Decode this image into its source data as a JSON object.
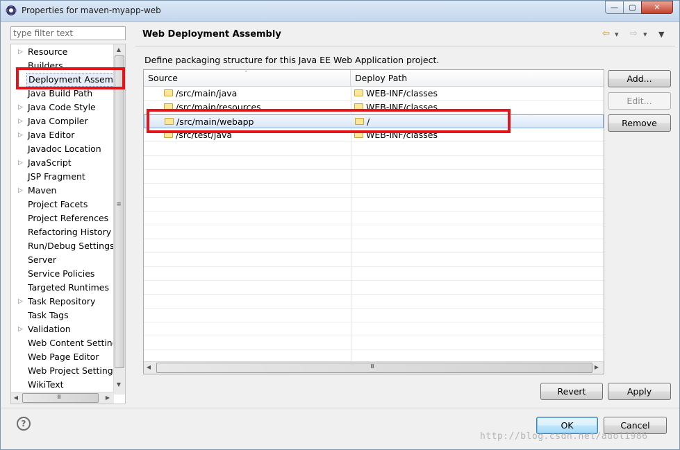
{
  "window": {
    "title": "Properties for maven-myapp-web",
    "min_glyph": "—",
    "max_glyph": "▢",
    "close_glyph": "✕"
  },
  "filter": {
    "placeholder": "type filter text"
  },
  "tree": {
    "items": [
      {
        "label": "Resource",
        "expandable": true
      },
      {
        "label": "Builders",
        "expandable": false
      },
      {
        "label": "Deployment Assembly",
        "expandable": false,
        "selected": true
      },
      {
        "label": "Java Build Path",
        "expandable": false
      },
      {
        "label": "Java Code Style",
        "expandable": true
      },
      {
        "label": "Java Compiler",
        "expandable": true
      },
      {
        "label": "Java Editor",
        "expandable": true
      },
      {
        "label": "Javadoc Location",
        "expandable": false
      },
      {
        "label": "JavaScript",
        "expandable": true
      },
      {
        "label": "JSP Fragment",
        "expandable": false
      },
      {
        "label": "Maven",
        "expandable": true
      },
      {
        "label": "Project Facets",
        "expandable": false
      },
      {
        "label": "Project References",
        "expandable": false
      },
      {
        "label": "Refactoring History",
        "expandable": false
      },
      {
        "label": "Run/Debug Settings",
        "expandable": false
      },
      {
        "label": "Server",
        "expandable": false
      },
      {
        "label": "Service Policies",
        "expandable": false
      },
      {
        "label": "Targeted Runtimes",
        "expandable": false
      },
      {
        "label": "Task Repository",
        "expandable": true
      },
      {
        "label": "Task Tags",
        "expandable": false
      },
      {
        "label": "Validation",
        "expandable": true
      },
      {
        "label": "Web Content Settings",
        "expandable": false
      },
      {
        "label": "Web Page Editor",
        "expandable": false
      },
      {
        "label": "Web Project Settings",
        "expandable": false
      },
      {
        "label": "WikiText",
        "expandable": false
      }
    ]
  },
  "page": {
    "title": "Web Deployment Assembly",
    "description": "Define packaging structure for this Java EE Web Application project."
  },
  "table": {
    "columns": [
      "Source",
      "Deploy Path"
    ],
    "rows": [
      {
        "source": "/src/main/java",
        "deploy": "WEB-INF/classes"
      },
      {
        "source": "/src/main/resources",
        "deploy": "WEB-INF/classes"
      },
      {
        "source": "/src/main/webapp",
        "deploy": "/",
        "selected": true
      },
      {
        "source": "/src/test/java",
        "deploy": "WEB-INF/classes"
      }
    ]
  },
  "buttons": {
    "add": "Add...",
    "edit": "Edit...",
    "remove": "Remove",
    "revert": "Revert",
    "apply": "Apply",
    "ok": "OK",
    "cancel": "Cancel"
  },
  "scroll_glyphs": {
    "up": "▲",
    "down": "▼",
    "left": "◀",
    "right": "▶",
    "grip": "Ⅲ"
  },
  "nav_glyphs": {
    "back": "⇦",
    "forward": "⇨",
    "menu": "▾"
  },
  "help_glyph": "?",
  "watermark": "http://blog.csdn.net/adol1986",
  "colors": {
    "annotation": "#e1151a",
    "selection": "#dae7f7"
  }
}
